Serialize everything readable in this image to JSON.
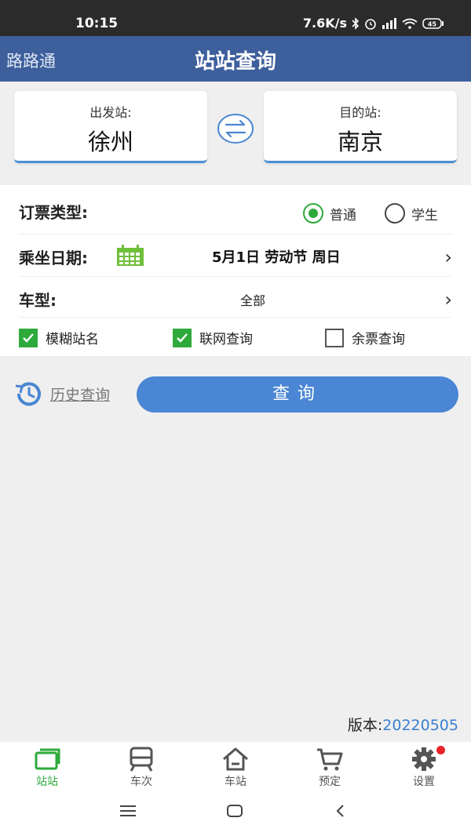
{
  "status": {
    "time": "10:15",
    "net_speed": "7.6K/s",
    "battery": "45"
  },
  "app": {
    "name": "路路通",
    "title": "站站查询"
  },
  "stations": {
    "from": {
      "label": "出发站:",
      "name": "徐州"
    },
    "to": {
      "label": "目的站:",
      "name": "南京"
    },
    "swap_icon": "swap-arrows-icon"
  },
  "form": {
    "ticket_type": {
      "label": "订票类型:",
      "options": [
        "普通",
        "学生"
      ],
      "selected": "普通"
    },
    "date": {
      "label": "乘坐日期:",
      "value": "5月1日 劳动节 周日"
    },
    "train_type": {
      "label": "车型:",
      "value": "全部"
    },
    "options": [
      {
        "label": "模糊站名",
        "checked": true
      },
      {
        "label": "联网查询",
        "checked": true
      },
      {
        "label": "余票查询",
        "checked": false
      }
    ]
  },
  "actions": {
    "history_label": "历史查询",
    "query_label": "查询"
  },
  "version": {
    "prefix": "版本:",
    "number": "20220505"
  },
  "tabs": [
    {
      "label": "站站",
      "icon": "stations-icon",
      "active": true
    },
    {
      "label": "车次",
      "icon": "train-icon",
      "active": false
    },
    {
      "label": "车站",
      "icon": "home-station-icon",
      "active": false
    },
    {
      "label": "预定",
      "icon": "cart-icon",
      "active": false
    },
    {
      "label": "设置",
      "icon": "gear-icon",
      "active": false,
      "badge": true
    }
  ],
  "colors": {
    "primary": "#3d5f9c",
    "accent_blue": "#4a86d3",
    "green": "#2eaa3c",
    "badge_red": "#e8232a"
  }
}
